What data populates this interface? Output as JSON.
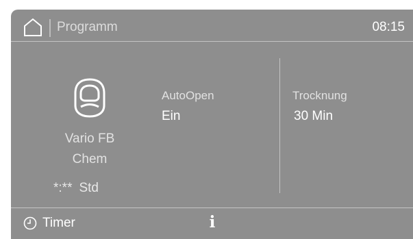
{
  "header": {
    "home_icon": "home-icon",
    "title": "Programm",
    "time": "08:15"
  },
  "program": {
    "icon": "mask-icon",
    "name_line1": "Vario FB",
    "name_line2": "Chem",
    "duration_value": "*:**",
    "duration_unit": "Std"
  },
  "settings": {
    "autoopen_label": "AutoOpen",
    "autoopen_value": "Ein",
    "drying_label": "Trocknung",
    "drying_value": "30 Min"
  },
  "footer": {
    "timer_icon": "clock-icon",
    "timer_label": "Timer",
    "info_icon": "info-icon",
    "info_glyph": "i"
  },
  "colors": {
    "screen_background": "#8e8e8e",
    "text": "#ffffff",
    "divider": "#c4c4c4"
  }
}
